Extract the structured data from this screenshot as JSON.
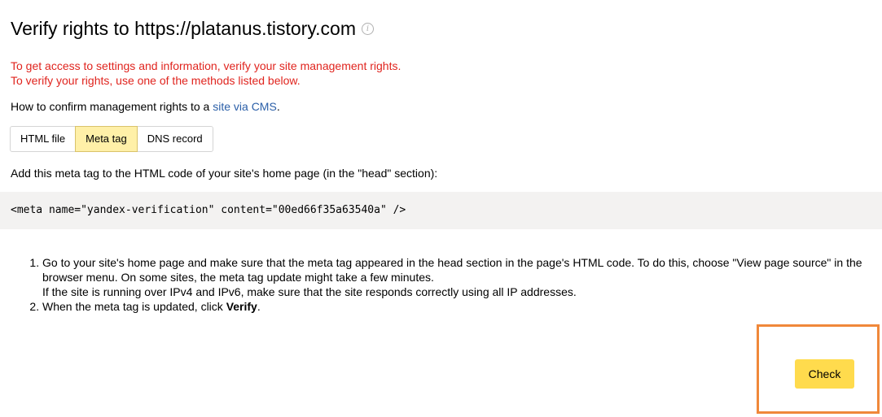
{
  "header": {
    "title": "Verify rights to https://platanus.tistory.com",
    "info_icon": "info-icon"
  },
  "warning": {
    "line1": "To get access to settings and information, verify your site management rights.",
    "line2": "To verify your rights, use one of the methods listed below."
  },
  "howto": {
    "prefix": "How to confirm management rights to a ",
    "link": "site via CMS",
    "suffix": "."
  },
  "tabs": [
    {
      "label": "HTML file",
      "active": false
    },
    {
      "label": "Meta tag",
      "active": true
    },
    {
      "label": "DNS record",
      "active": false
    }
  ],
  "instruction": "Add this meta tag to the HTML code of your site's home page (in the \"head\" section):",
  "code": "<meta name=\"yandex-verification\" content=\"00ed66f35a63540a\" />",
  "steps": {
    "step1_line1": "Go to your site's home page and make sure that the meta tag appeared in the head section in the page's HTML code. To do this, choose \"View page source\" in the browser menu. On some sites, the meta tag update might take a few minutes.",
    "step1_line2": "If the site is running over IPv4 and IPv6, make sure that the site responds correctly using all IP addresses.",
    "step2_prefix": "When the meta tag is updated, click ",
    "step2_bold": "Verify",
    "step2_suffix": "."
  },
  "check_button": {
    "label": "Check"
  },
  "colors": {
    "warning": "#e0241e",
    "link": "#2b5fa8",
    "active_tab": "#fff0a8",
    "button": "#ffdb4d",
    "highlight_border": "#f0883a",
    "code_bg": "#f3f2f1"
  }
}
